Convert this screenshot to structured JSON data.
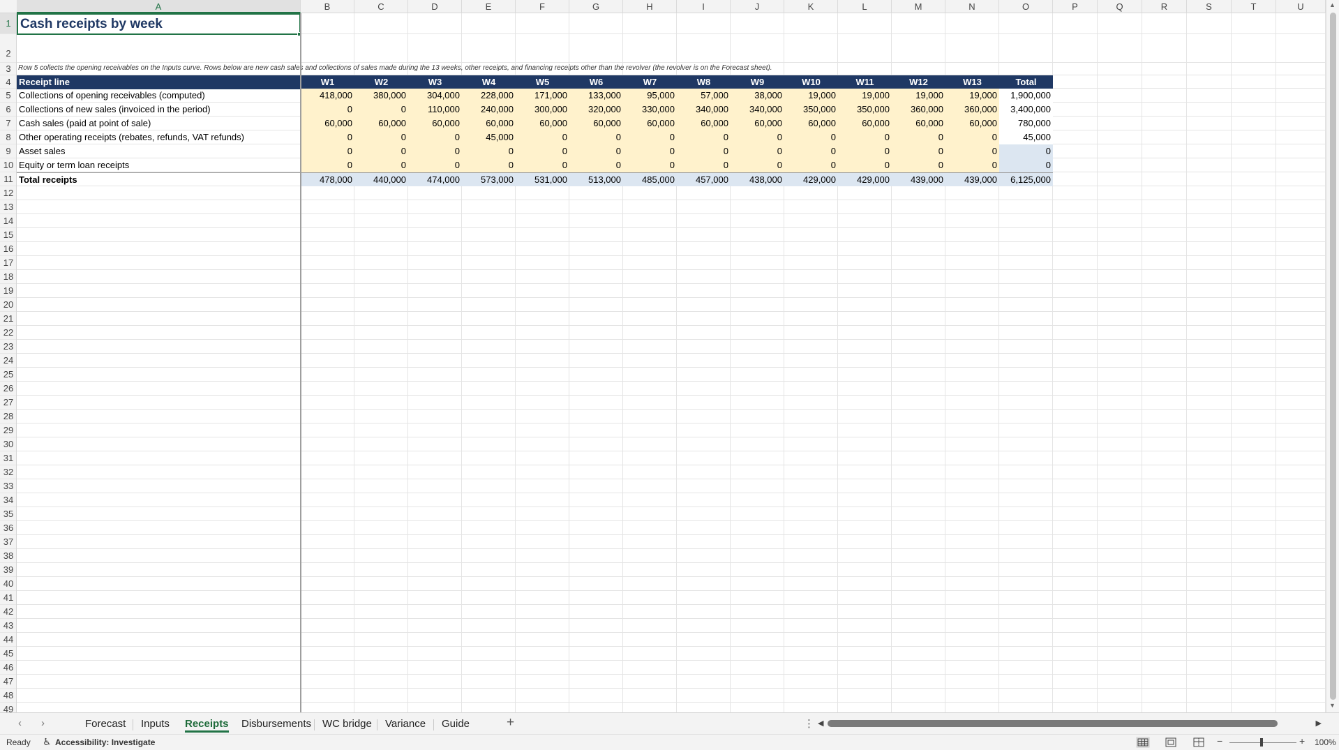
{
  "columns": [
    "A",
    "B",
    "C",
    "D",
    "E",
    "F",
    "G",
    "H",
    "I",
    "J",
    "K",
    "L",
    "M",
    "N",
    "O",
    "P",
    "Q",
    "R",
    "S",
    "T",
    "U"
  ],
  "rows": [
    "1",
    "2",
    "3",
    "4",
    "5",
    "6",
    "7",
    "8",
    "9",
    "10",
    "11",
    "12",
    "13",
    "14",
    "15",
    "16",
    "17",
    "18",
    "19",
    "20",
    "21",
    "22",
    "23",
    "24",
    "25",
    "26",
    "27",
    "28",
    "29",
    "30",
    "31",
    "32",
    "33",
    "34",
    "35",
    "36",
    "37",
    "38",
    "39",
    "40",
    "41",
    "42",
    "43",
    "44",
    "45",
    "46",
    "47",
    "48",
    "49"
  ],
  "sheet": {
    "title": "Cash receipts by week",
    "note": "Row 5 collects the opening receivables on the Inputs curve. Rows below are new cash sales and collections of sales made during the 13 weeks, other receipts, and financing receipts other than the revolver (the revolver is on the Forecast sheet).",
    "table_header": [
      "Receipt line",
      "W1",
      "W2",
      "W3",
      "W4",
      "W5",
      "W6",
      "W7",
      "W8",
      "W9",
      "W10",
      "W11",
      "W12",
      "W13",
      "Total"
    ],
    "table_rows": [
      {
        "label": "Collections of opening receivables (computed)",
        "values": [
          "418,000",
          "380,000",
          "304,000",
          "228,000",
          "171,000",
          "133,000",
          "95,000",
          "57,000",
          "38,000",
          "19,000",
          "19,000",
          "19,000",
          "19,000",
          "1,900,000"
        ],
        "fill": "input"
      },
      {
        "label": "Collections of new sales (invoiced in the period)",
        "values": [
          "0",
          "0",
          "110,000",
          "240,000",
          "300,000",
          "320,000",
          "330,000",
          "340,000",
          "340,000",
          "350,000",
          "350,000",
          "360,000",
          "360,000",
          "3,400,000"
        ],
        "fill": "input"
      },
      {
        "label": "Cash sales (paid at point of sale)",
        "values": [
          "60,000",
          "60,000",
          "60,000",
          "60,000",
          "60,000",
          "60,000",
          "60,000",
          "60,000",
          "60,000",
          "60,000",
          "60,000",
          "60,000",
          "60,000",
          "780,000"
        ],
        "fill": "input"
      },
      {
        "label": "Other operating receipts (rebates, refunds, VAT refunds)",
        "values": [
          "0",
          "0",
          "0",
          "45,000",
          "0",
          "0",
          "0",
          "0",
          "0",
          "0",
          "0",
          "0",
          "0",
          "45,000"
        ],
        "fill": "input"
      },
      {
        "label": "Asset sales",
        "values": [
          "0",
          "0",
          "0",
          "0",
          "0",
          "0",
          "0",
          "0",
          "0",
          "0",
          "0",
          "0",
          "0",
          "0"
        ],
        "fill": "input"
      },
      {
        "label": "Equity or term loan receipts",
        "values": [
          "0",
          "0",
          "0",
          "0",
          "0",
          "0",
          "0",
          "0",
          "0",
          "0",
          "0",
          "0",
          "0",
          "0"
        ],
        "fill": "input"
      }
    ],
    "total_row": {
      "label": "Total receipts",
      "values": [
        "478,000",
        "440,000",
        "474,000",
        "573,000",
        "531,000",
        "513,000",
        "485,000",
        "457,000",
        "438,000",
        "429,000",
        "429,000",
        "439,000",
        "439,000",
        "6,125,000"
      ]
    }
  },
  "tabs": [
    "Forecast",
    "Inputs",
    "Receipts",
    "Disbursements",
    "WC bridge",
    "Variance",
    "Guide"
  ],
  "active_tab": "Receipts",
  "status": {
    "ready": "Ready",
    "accessibility": "Accessibility: Investigate",
    "zoom": "100%"
  },
  "colors": {
    "header_fill": "#1f3864",
    "input_fill": "#fff2cc",
    "total_fill": "#dce6f1",
    "accent": "#217346"
  }
}
